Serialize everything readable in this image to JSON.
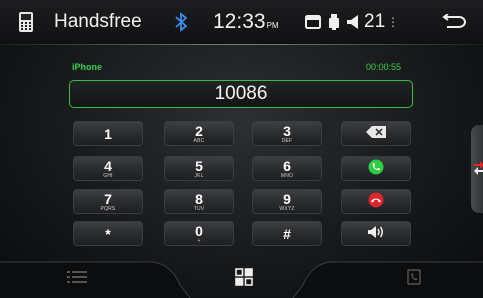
{
  "status_bar": {
    "app_icon": "phone-app-icon",
    "title": "Handsfree",
    "bluetooth_icon": "bluetooth-icon",
    "time": "12:33",
    "ampm": "PM",
    "sd_icon": "sd-card-icon",
    "usb_icon": "usb-icon",
    "volume_icon": "speaker-icon",
    "volume_level": "21",
    "back_icon": "back-arrow-icon"
  },
  "call": {
    "device": "iPhone",
    "timer": "00:00:55",
    "number": "10086"
  },
  "keypad": {
    "k1": {
      "digit": "1",
      "letters": ""
    },
    "k2": {
      "digit": "2",
      "letters": "ABC"
    },
    "k3": {
      "digit": "3",
      "letters": "DEF"
    },
    "k4": {
      "digit": "4",
      "letters": "GHI"
    },
    "k5": {
      "digit": "5",
      "letters": "JKL"
    },
    "k6": {
      "digit": "6",
      "letters": "MNO"
    },
    "k7": {
      "digit": "7",
      "letters": "PQRS"
    },
    "k8": {
      "digit": "8",
      "letters": "TUV"
    },
    "k9": {
      "digit": "9",
      "letters": "WXYZ"
    },
    "kstar": {
      "digit": "*"
    },
    "k0": {
      "digit": "0",
      "letters": "+"
    },
    "khash": {
      "digit": "#"
    }
  },
  "actions": {
    "backspace_icon": "backspace-icon",
    "answer_icon": "answer-call-icon",
    "hangup_icon": "hang-up-icon",
    "audio_icon": "audio-transfer-icon"
  },
  "colors": {
    "accent_green": "#3dbb46",
    "answer_green": "#2ecc40",
    "hangup_red": "#e0262c"
  },
  "bottom_bar": {
    "contacts_icon": "contacts-list-icon",
    "menu_icon": "menu-grid-icon",
    "calllog_icon": "call-log-icon"
  }
}
